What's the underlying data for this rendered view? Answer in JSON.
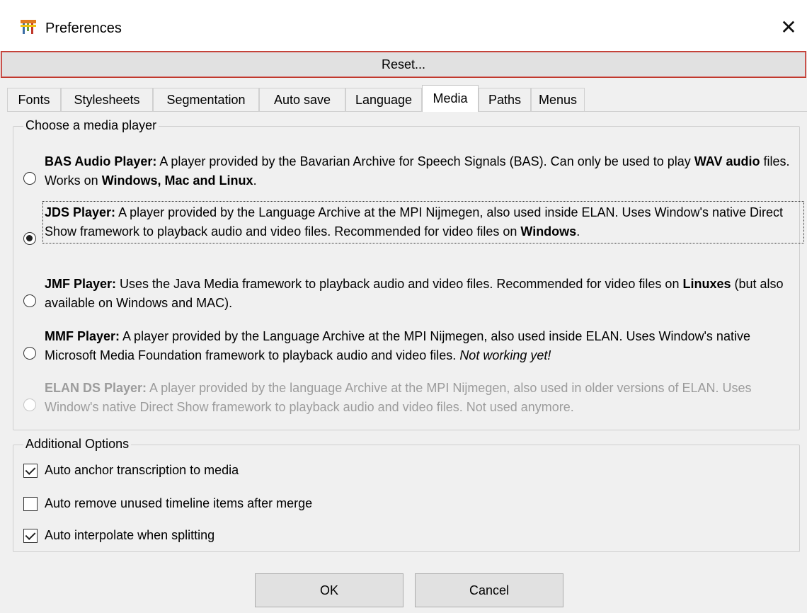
{
  "window": {
    "title": "Preferences"
  },
  "toolbar": {
    "reset_label": "Reset..."
  },
  "tabs": [
    {
      "label": "Fonts"
    },
    {
      "label": "Stylesheets"
    },
    {
      "label": "Segmentation"
    },
    {
      "label": "Auto save"
    },
    {
      "label": "Language"
    },
    {
      "label": "Media",
      "active": true
    },
    {
      "label": "Paths"
    },
    {
      "label": "Menus"
    }
  ],
  "media": {
    "player_group_label": "Choose a media player",
    "players": [
      {
        "name": "BAS Audio Player:",
        "parts": [
          " A player provided by the Bavarian Archive for Speech Signals (BAS). Can only be used to play ",
          "WAV audio",
          " files. Works on ",
          "Windows, Mac and Linux",
          "."
        ],
        "selected": false,
        "disabled": false
      },
      {
        "name": "JDS Player:",
        "parts": [
          " A player provided by the Language Archive at the MPI Nijmegen, also used inside ELAN. Uses Window's native Direct Show framework to playback audio and video files. Recommended for video files on ",
          "Windows",
          "."
        ],
        "selected": true,
        "disabled": false
      },
      {
        "name": "JMF Player:",
        "parts": [
          " Uses the Java Media framework to playback audio and video files. Recommended for video files on ",
          "Linuxes",
          " (but also available on Windows and MAC)."
        ],
        "selected": false,
        "disabled": false
      },
      {
        "name": "MMF Player:",
        "parts": [
          " A player provided by the Language Archive at the MPI Nijmegen, also used inside ELAN. Uses Window's native Microsoft Media Foundation framework to playback audio and video files. ",
          "Not working yet!"
        ],
        "selected": false,
        "disabled": false
      },
      {
        "name": "ELAN DS Player:",
        "parts": [
          " A player provided by the language Archive at the MPI Nijmegen, also used in older versions of ELAN. Uses Window's native Direct Show framework to playback audio and video files. Not used anymore."
        ],
        "selected": false,
        "disabled": true
      }
    ],
    "options_group_label": "Additional Options",
    "options": [
      {
        "label": "Auto anchor transcription to media",
        "checked": true
      },
      {
        "label": "Auto remove unused timeline items after merge",
        "checked": false
      },
      {
        "label": "Auto interpolate when splitting",
        "checked": true
      }
    ]
  },
  "buttons": {
    "ok_label": "OK",
    "cancel_label": "Cancel"
  },
  "icons": {
    "app": "elan-app-icon",
    "close": "close-icon"
  },
  "colors": {
    "reset_border": "#c0392b",
    "active_tab_bg": "#ffffff",
    "dialog_bg": "#f0f0f0"
  }
}
